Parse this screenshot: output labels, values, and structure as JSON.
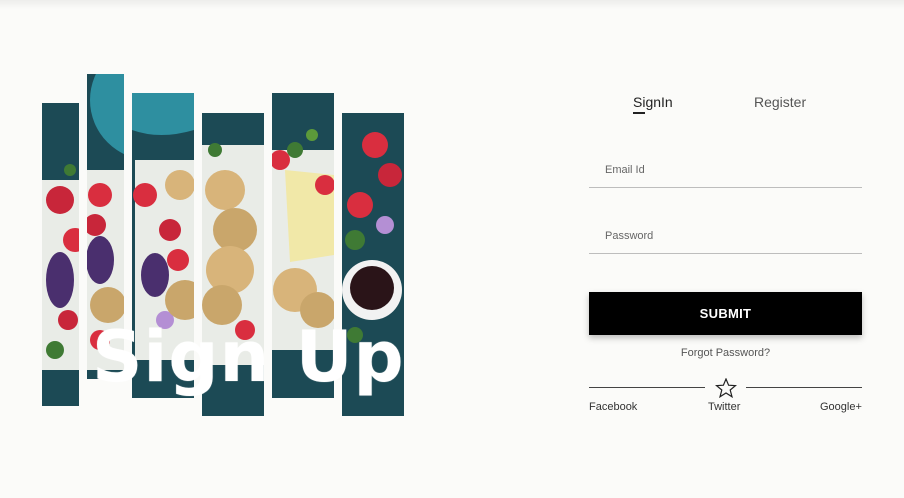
{
  "hero": {
    "title": "Sign Up"
  },
  "tabs": [
    {
      "label": "SignIn",
      "active": true
    },
    {
      "label": "Register",
      "active": false
    }
  ],
  "form": {
    "email_placeholder": "Email Id",
    "password_placeholder": "Password",
    "submit_label": "SUBMIT",
    "forgot_label": "Forgot Password?"
  },
  "social": {
    "divider_icon": "star-outline-icon",
    "links": [
      "Facebook",
      "Twitter",
      "Google+"
    ]
  },
  "colors": {
    "background": "#fbfbf9",
    "button": "#000000",
    "image_teal": "#1c4a55"
  }
}
